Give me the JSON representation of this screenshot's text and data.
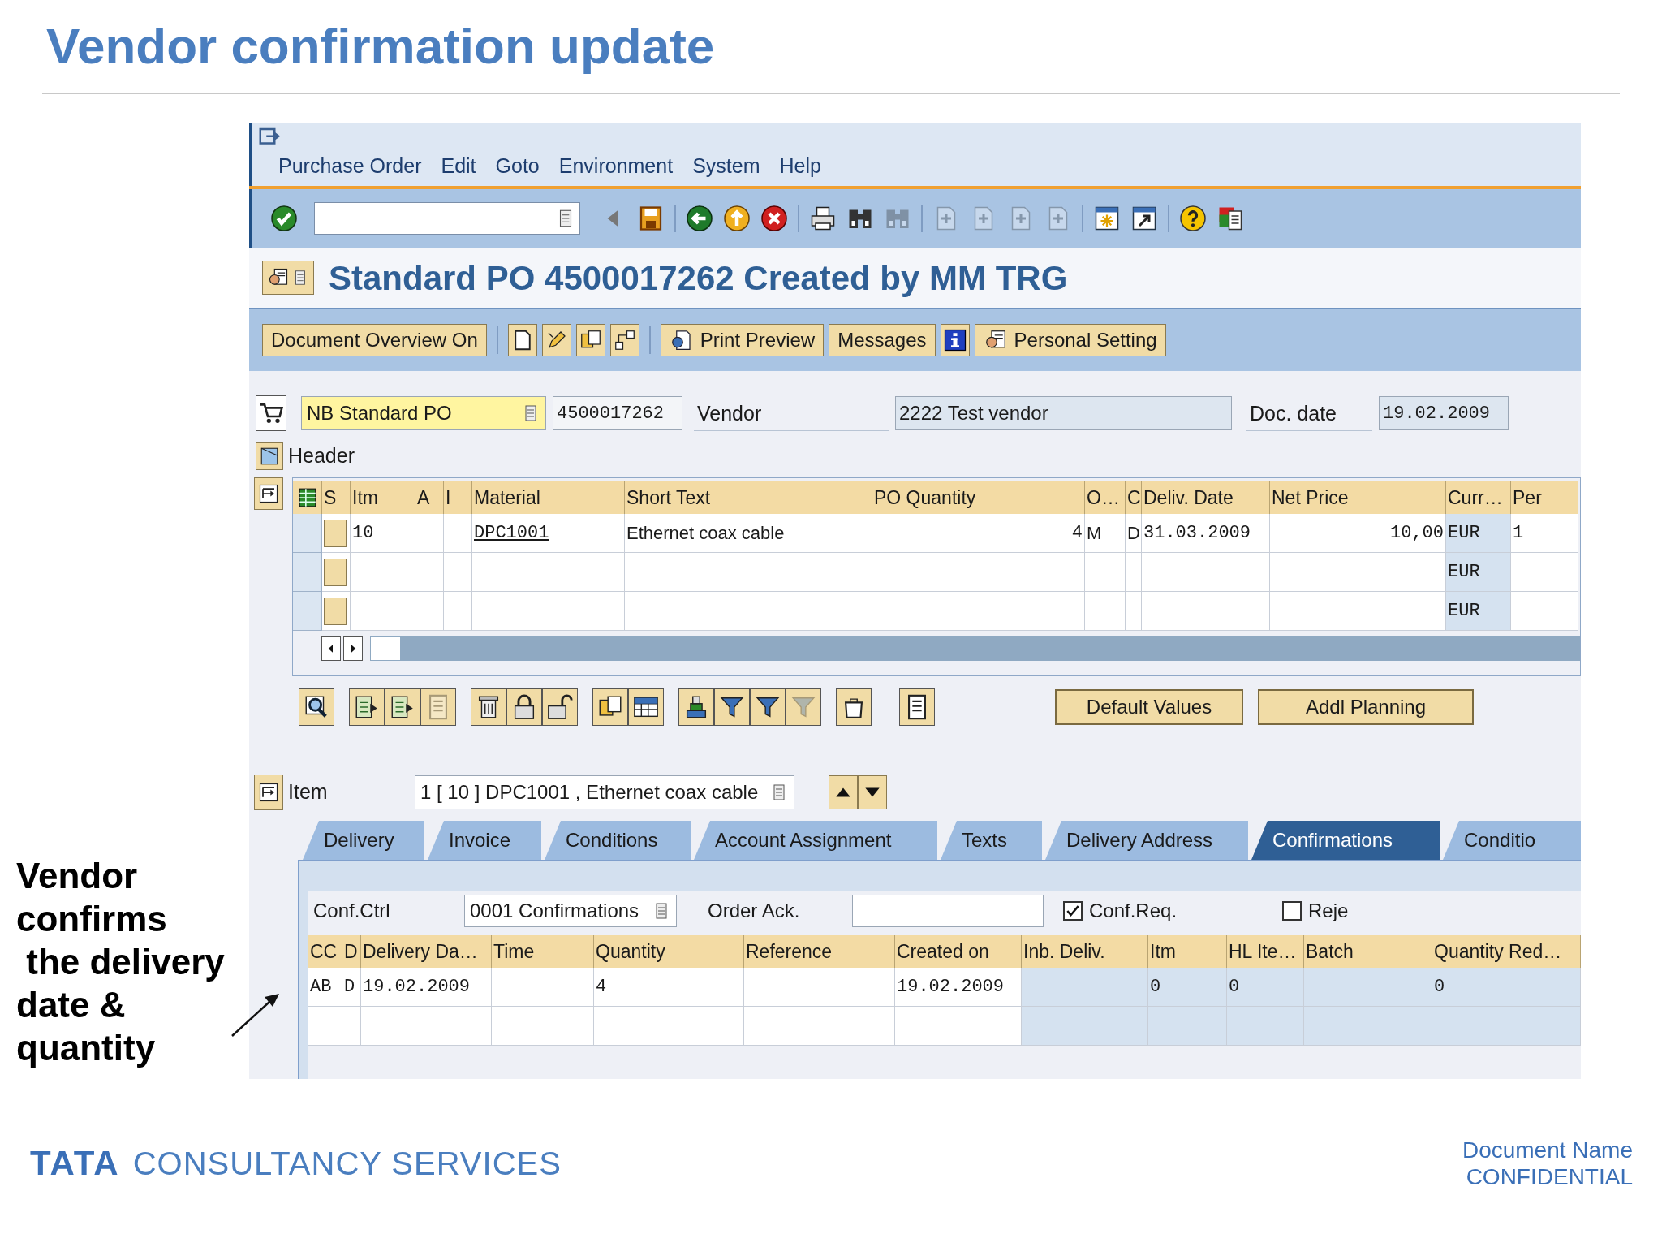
{
  "slide": {
    "title": "Vendor confirmation update",
    "annotation": [
      "Vendor",
      "confirms",
      " the delivery",
      "date &",
      "quantity"
    ]
  },
  "sap": {
    "menu": [
      "Purchase Order",
      "Edit",
      "Goto",
      "Environment",
      "System",
      "Help"
    ],
    "standard_toolbar": [
      {
        "disabled": false
      },
      {
        "disabled": false
      },
      {
        "disabled": false
      },
      {
        "disabled": false
      },
      {
        "disabled": false
      },
      {
        "disabled": false
      },
      {
        "disabled": false
      },
      {
        "disabled": false
      },
      {
        "disabled": true
      },
      {
        "disabled": true
      },
      {
        "disabled": true
      },
      {
        "disabled": true
      },
      {
        "disabled": true
      },
      {
        "disabled": false
      },
      {
        "disabled": false
      },
      {
        "disabled": false
      },
      {
        "disabled": false
      }
    ],
    "title": "Standard PO 4500017262 Created by MM TRG",
    "app_buttons": {
      "document_overview": "Document Overview On",
      "print_preview": "Print Preview",
      "messages": "Messages",
      "personal_setting": "Personal Setting"
    },
    "doc_type": "NB Standard PO",
    "po_number": "4500017262",
    "vendor_label": "Vendor",
    "vendor": "2222 Test vendor",
    "doc_date_label": "Doc. date",
    "doc_date": "19.02.2009",
    "header_label": "Header",
    "items": {
      "columns": [
        "S",
        "Itm",
        "A",
        "I",
        "Material",
        "Short Text",
        "PO Quantity",
        "O…",
        "C",
        "Deliv. Date",
        "Net Price",
        "Curr…",
        "Per"
      ],
      "rows": [
        [
          null,
          "10",
          null,
          null,
          "DPC1001",
          "Ethernet coax cable",
          "4",
          "M",
          "D",
          "31.03.2009",
          "10,00",
          "EUR",
          "1"
        ],
        [
          null,
          null,
          null,
          null,
          null,
          null,
          null,
          null,
          null,
          null,
          null,
          "EUR",
          null
        ],
        [
          null,
          null,
          null,
          null,
          null,
          null,
          null,
          null,
          null,
          null,
          null,
          "EUR",
          null
        ]
      ]
    },
    "grid_tools": [
      {
        "disabled": false
      },
      {
        "disabled": false
      },
      {
        "disabled": false
      },
      {
        "disabled": true
      },
      {
        "disabled": false
      },
      {
        "disabled": false
      },
      {
        "disabled": false
      },
      {
        "disabled": false
      },
      {
        "disabled": false
      },
      {
        "disabled": false
      },
      {
        "disabled": false
      },
      {
        "disabled": false
      },
      {
        "disabled": true
      },
      {
        "disabled": false
      },
      {
        "disabled": false
      }
    ],
    "buttons": [
      "Default Values",
      "Addl Planning"
    ],
    "item_label": "Item",
    "item_value": "1 [ 10 ] DPC1001 , Ethernet coax cable",
    "tabs": [
      {
        "label": "Delivery",
        "selected": false
      },
      {
        "label": "Invoice",
        "selected": false
      },
      {
        "label": "Conditions",
        "selected": false
      },
      {
        "label": "Account Assignment",
        "selected": false
      },
      {
        "label": "Texts",
        "selected": false
      },
      {
        "label": "Delivery Address",
        "selected": false
      },
      {
        "label": "Confirmations",
        "selected": true
      },
      {
        "label": "Conditio",
        "selected": false
      }
    ],
    "confirmations": {
      "conf_ctrl_label": "Conf.Ctrl",
      "conf_ctrl": "0001 Confirmations",
      "order_ack_label": "Order Ack.",
      "conf_req": {
        "label": "Conf.Req.",
        "checked": true
      },
      "rejected": {
        "label": "Reje",
        "checked": false
      },
      "columns": [
        "CC",
        "D",
        "Delivery Da…",
        "Time",
        "Quantity",
        "Reference",
        "Created on",
        "Inb. Deliv.",
        "Itm",
        "HL Ite…",
        "Batch",
        "Quantity Red…"
      ],
      "rows": [
        [
          "AB",
          "D",
          "19.02.2009",
          null,
          "4",
          null,
          "19.02.2009",
          null,
          "0",
          "0",
          null,
          "0"
        ],
        [
          null,
          null,
          null,
          null,
          null,
          null,
          null,
          null,
          null,
          null,
          null,
          null
        ]
      ]
    }
  },
  "footer": {
    "logo_mark": "TATA",
    "logo_text": "CONSULTANCY SERVICES",
    "document_name": "Document Name",
    "classification": "CONFIDENTIAL"
  }
}
